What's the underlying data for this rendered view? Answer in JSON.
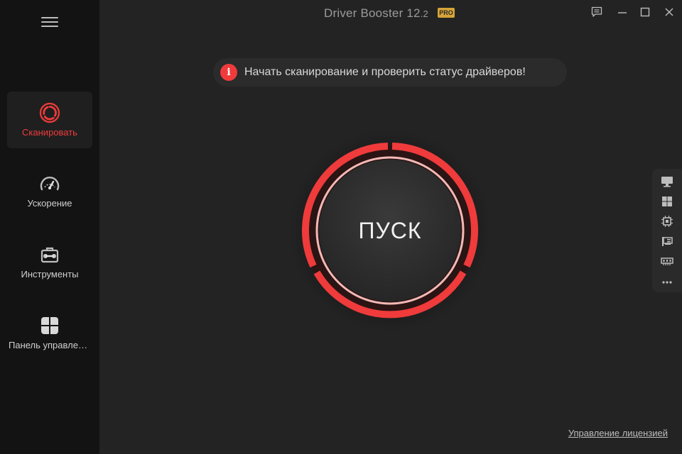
{
  "window": {
    "title": "Driver Booster 12",
    "version": ".2",
    "badge": "PRO"
  },
  "sidebar": {
    "items": [
      {
        "label": "Сканировать",
        "icon": "scan-icon",
        "active": true
      },
      {
        "label": "Ускорение",
        "icon": "speedometer-icon",
        "active": false
      },
      {
        "label": "Инструменты",
        "icon": "toolbox-icon",
        "active": false
      },
      {
        "label": "Панель управления",
        "icon": "grid-icon",
        "active": false
      }
    ]
  },
  "notice": {
    "icon": "info-icon",
    "icon_glyph": "i",
    "text": "Начать сканирование и проверить статус драйверов!"
  },
  "scan": {
    "button_label": "ПУСК"
  },
  "side_panel": {
    "icons": [
      "monitor-icon",
      "windows-icon",
      "chip-icon",
      "network-card-icon",
      "memory-icon",
      "more-icon"
    ]
  },
  "footer": {
    "license_link": "Управление лицензией"
  },
  "colors": {
    "accent": "#ef3b3b",
    "ring_inner": "#f2b8b5",
    "badge": "#d6a437"
  }
}
